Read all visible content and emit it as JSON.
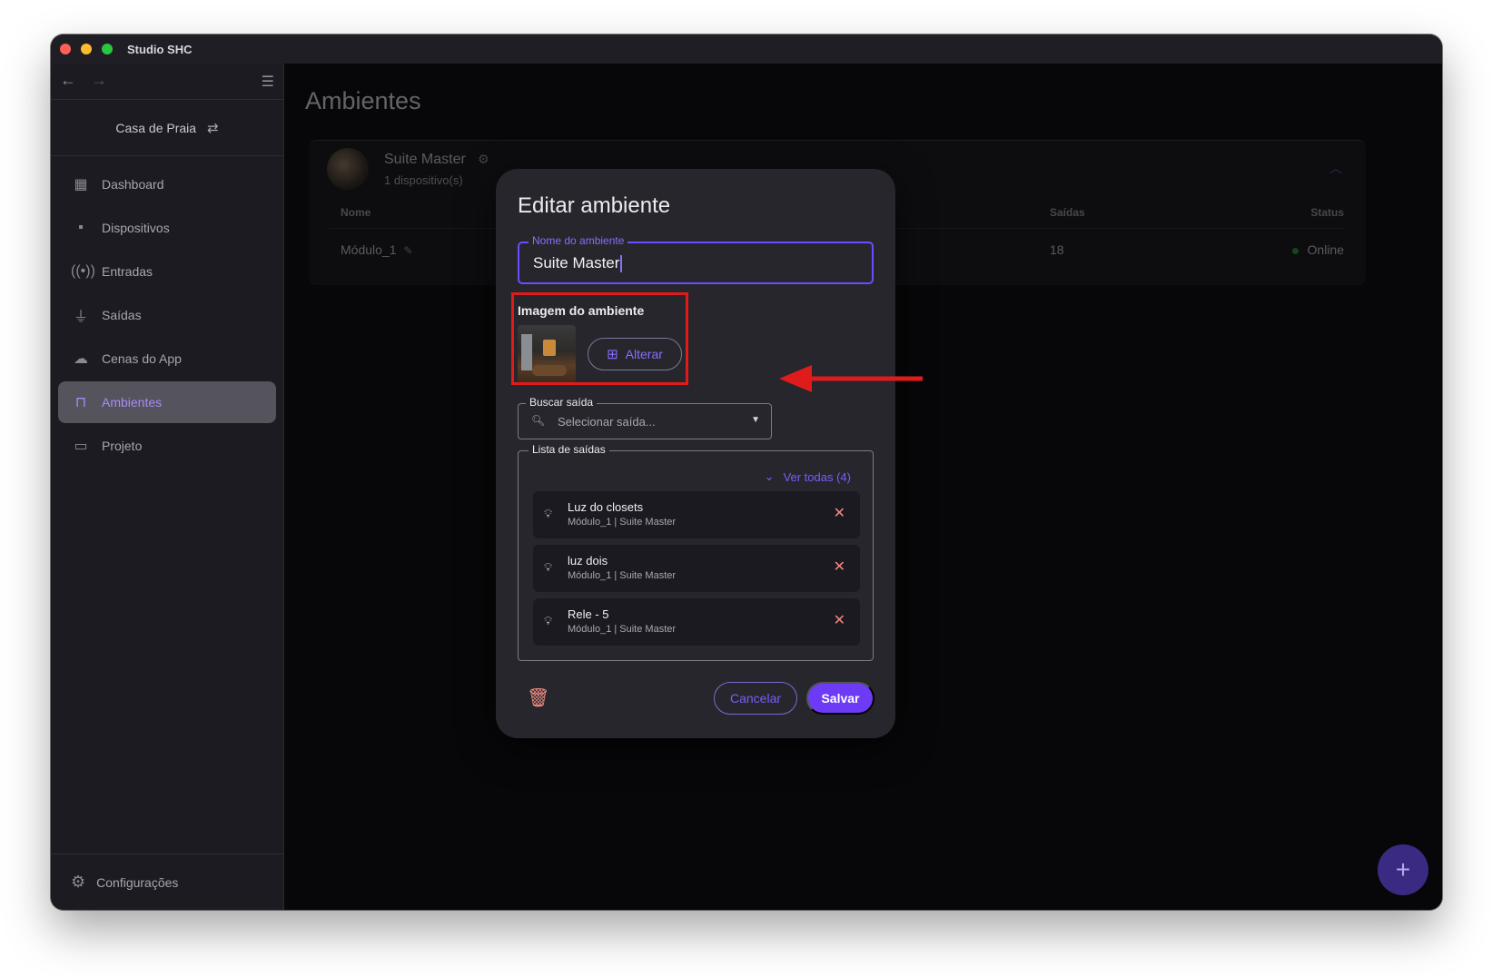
{
  "window": {
    "title": "Studio SHC"
  },
  "sidebar": {
    "project_name": "Casa de Praia",
    "items": [
      {
        "label": "Dashboard",
        "icon": "dashboard-icon"
      },
      {
        "label": "Dispositivos",
        "icon": "devices-icon"
      },
      {
        "label": "Entradas",
        "icon": "broadcast-icon"
      },
      {
        "label": "Saídas",
        "icon": "plug-icon"
      },
      {
        "label": "Cenas do App",
        "icon": "cloud-icon"
      },
      {
        "label": "Ambientes",
        "icon": "door-icon",
        "active": true
      },
      {
        "label": "Projeto",
        "icon": "folder-icon"
      }
    ],
    "settings_label": "Configurações"
  },
  "main": {
    "title": "Ambientes",
    "room": {
      "name": "Suite Master",
      "device_count": "1 dispositivo(s)",
      "columns": {
        "nome": "Nome",
        "saidas": "Saídas",
        "status": "Status"
      },
      "rows": [
        {
          "nome": "Módulo_1",
          "saidas": "18",
          "status": "Online"
        }
      ]
    }
  },
  "dialog": {
    "title": "Editar ambiente",
    "name_field": {
      "label": "Nome do ambiente",
      "value": "Suite Master"
    },
    "image_section": {
      "label": "Imagem do ambiente",
      "change_label": "Alterar"
    },
    "search_field": {
      "label": "Buscar saída",
      "placeholder": "Selecionar saída..."
    },
    "outputs": {
      "label": "Lista de saídas",
      "see_all": "Ver todas (4)",
      "items": [
        {
          "name": "Luz do closets",
          "sub": "Módulo_1 | Suite Master"
        },
        {
          "name": "luz dois",
          "sub": "Módulo_1 | Suite Master"
        },
        {
          "name": "Rele - 5",
          "sub": "Módulo_1 | Suite Master"
        }
      ]
    },
    "cancel_label": "Cancelar",
    "save_label": "Salvar"
  },
  "colors": {
    "accent": "#6d3bf5",
    "highlight": "#e01b1b",
    "online": "#1f6b33"
  }
}
